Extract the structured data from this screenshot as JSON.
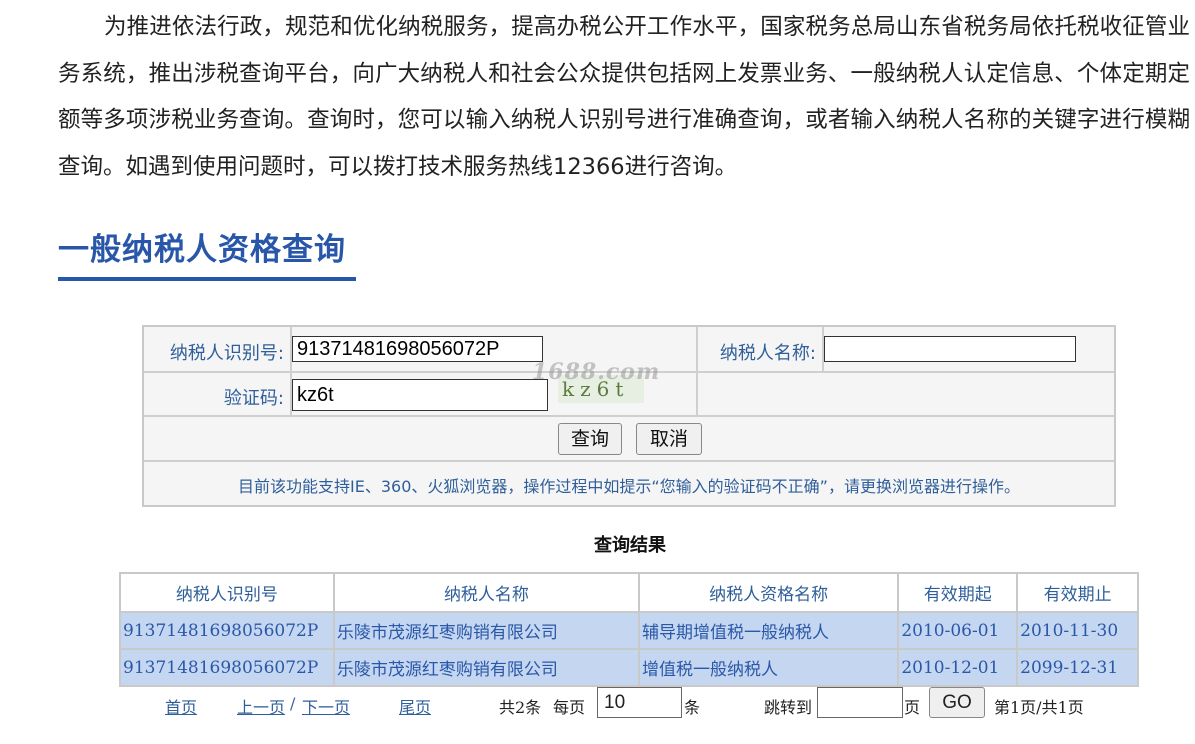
{
  "intro": {
    "paragraph": "为推进依法行政，规范和优化纳税服务，提高办税公开工作水平，国家税务总局山东省税务局依托税收征管业务系统，推出涉税查询平台，向广大纳税人和社会公众提供包括网上发票业务、一般纳税人认定信息、个体定期定额等多项涉税业务查询。查询时，您可以输入纳税人识别号进行准确查询，或者输入纳税人名称的关键字进行模糊查询。如遇到使用问题时，可以拨打技术服务热线12366进行咨询。"
  },
  "section": {
    "title": "一般纳税人资格查询"
  },
  "form": {
    "taxpayer_id_label": "纳税人识别号:",
    "taxpayer_id_value": "91371481698056072P",
    "taxpayer_name_label": "纳税人名称:",
    "taxpayer_name_value": "",
    "captcha_label": "验证码:",
    "captcha_value": "kz6t",
    "captcha_image_text": "kz6t",
    "watermark": "1688.com",
    "query_button": "查询",
    "cancel_button": "取消",
    "notice": "目前该功能支持IE、360、火狐浏览器，操作过程中如提示“您输入的验证码不正确”，请更换浏览器进行操作。"
  },
  "results": {
    "title": "查询结果",
    "headers": [
      "纳税人识别号",
      "纳税人名称",
      "纳税人资格名称",
      "有效期起",
      "有效期止"
    ],
    "rows": [
      [
        "91371481698056072P",
        "乐陵市茂源红枣购销有限公司",
        "辅导期增值税一般纳税人",
        "2010-06-01",
        "2010-11-30"
      ],
      [
        "91371481698056072P",
        "乐陵市茂源红枣购销有限公司",
        "增值税一般纳税人",
        "2010-12-01",
        "2099-12-31"
      ]
    ]
  },
  "pager": {
    "first": "首页",
    "prev": "上一页",
    "separator": "/",
    "next": "下一页",
    "last": "尾页",
    "total": "共2条",
    "per_page_label": "每页",
    "per_page_value": "10",
    "per_page_unit": "条",
    "jump_label": "跳转到",
    "jump_value": "",
    "jump_unit": "页",
    "go_button": "GO",
    "page_info": "第1页/共1页"
  },
  "colors": {
    "title_blue": "#2856a8",
    "label_blue": "#2f5f9a",
    "row_highlight": "#c5d6f1"
  }
}
